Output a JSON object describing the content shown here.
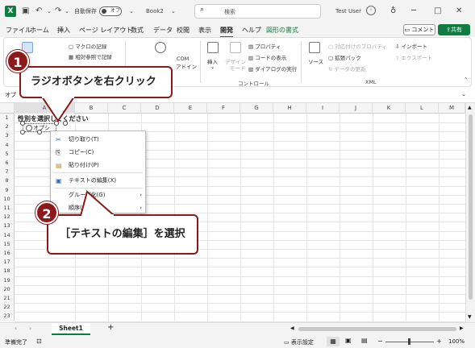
{
  "titlebar": {
    "app_icon": "excel-icon",
    "autosave_label": "自動保存",
    "autosave_state": "オフ",
    "filename": "Book2",
    "search_placeholder": "検索",
    "user": "Test User"
  },
  "tabs": [
    "ファイル",
    "ホーム",
    "挿入",
    "ページ レイアウト",
    "数式",
    "データ",
    "校閲",
    "表示",
    "開発",
    "ヘルプ",
    "図形の書式"
  ],
  "active_tab": "開発",
  "buttons": {
    "comment": "コメント",
    "share": "共有"
  },
  "ribbon": {
    "macro_record": "マクロの記録",
    "relative_ref": "相対参照で記録",
    "com_addin_1": "COM",
    "com_addin_2": "アドイン",
    "insert": "挿入",
    "design_mode_1": "デザイン",
    "design_mode_2": "モード",
    "properties": "プロパティ",
    "view_code": "コードの表示",
    "run_dialog": "ダイアログの実行",
    "controls_group": "コントロール",
    "source": "ソース",
    "map_properties": "対応付けのプロパティ",
    "expansion_pack": "拡張パック",
    "refresh_data": "データの更新",
    "import": "インポート",
    "export": "エクスポート",
    "xml_group": "XML"
  },
  "formula": {
    "namebox": "オプ"
  },
  "columns": [
    "A",
    "B",
    "C",
    "D",
    "E",
    "F",
    "G",
    "H",
    "I",
    "J",
    "K",
    "L",
    "M"
  ],
  "rows": [
    "1",
    "2",
    "3",
    "4",
    "5",
    "6",
    "7",
    "8",
    "9",
    "10",
    "11",
    "12",
    "13",
    "14",
    "15",
    "16",
    "17",
    "18",
    "19",
    "20",
    "21",
    "22",
    "23"
  ],
  "cells": {
    "a1": "性別を選択してください",
    "radio_label": "オプシ"
  },
  "context_menu": {
    "cut": "切り取り(T)",
    "copy": "コピー(C)",
    "paste": "貼り付け(P)",
    "edit_text": "テキストの編集(X)",
    "group": "グループ化(G)",
    "order": "順序(R)"
  },
  "callouts": {
    "step1_num": "1",
    "step1_text": "ラジオボタンを右クリック",
    "step2_num": "2",
    "step2_text": "［テキストの編集］を選択"
  },
  "sheet": {
    "tab": "Sheet1",
    "add": "+"
  },
  "status": {
    "ready": "準備完了",
    "display_settings": "表示設定",
    "zoom": "100%"
  },
  "colors": {
    "accent": "#107c41",
    "callout": "#8b1a1a"
  }
}
